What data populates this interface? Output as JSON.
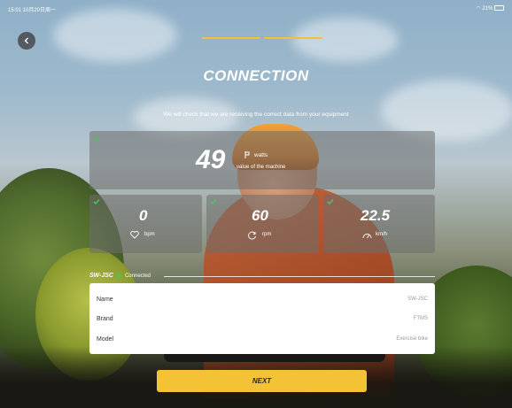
{
  "status_bar": {
    "left": "15:01 10月20日周一",
    "right": "21%"
  },
  "header": {
    "title": "CONNECTION",
    "subtitle": "We will check that we are receiving the correct data from your equipment"
  },
  "power": {
    "value": "49",
    "unit": "watts",
    "desc": "value of the machine"
  },
  "metrics": [
    {
      "value": "0",
      "unit": "bpm",
      "icon": "heart-icon"
    },
    {
      "value": "60",
      "unit": "rpm",
      "icon": "cadence-icon"
    },
    {
      "value": "22.5",
      "unit": "km/h",
      "icon": "speedometer-icon"
    }
  ],
  "device": {
    "name": "SW-JSC",
    "status": "Connected",
    "rows": [
      {
        "label": "Name",
        "value": "SW-JSC"
      },
      {
        "label": "Brand",
        "value": "FTMS"
      },
      {
        "label": "Model",
        "value": "Exercise bike"
      }
    ]
  },
  "next_label": "NEXT",
  "colors": {
    "accent": "#f4c335",
    "check": "#4cc35a"
  }
}
